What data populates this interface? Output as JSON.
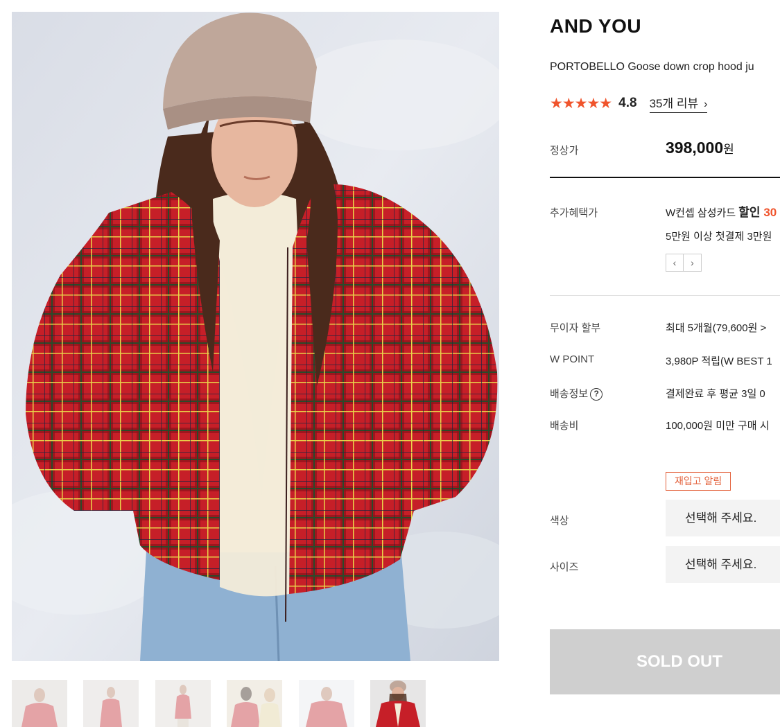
{
  "product": {
    "brand": "AND YOU",
    "name": "PORTOBELLO Goose down crop hood ju",
    "rating_stars": "★★★★★",
    "rating": "4.8",
    "review_link": "35개 리뷰",
    "review_chevron": "›"
  },
  "price": {
    "label": "정상가",
    "amount": "398,000",
    "unit": "원"
  },
  "benefits": {
    "label": "추가혜택가",
    "line1_prefix": "W컨셉 삼성카드 ",
    "line1_strong": "할인 ",
    "line1_accent": "30",
    "line2": "5만원 이상 첫결제 3만원",
    "prev_icon": "‹",
    "next_icon": "›"
  },
  "info": {
    "installment_label": "무이자 할부",
    "installment_value": "최대 5개월(79,600원 >",
    "point_label": "W POINT",
    "point_value": "3,980P 적립(W BEST 1",
    "shipping_info_label": "배송정보",
    "shipping_help_icon": "?",
    "shipping_info_value": "결제완료 후 평균 3일 0",
    "shipping_fee_label": "배송비",
    "shipping_fee_value": "100,000원 미만 구매 시"
  },
  "options": {
    "restock_button": "재입고 알림",
    "color_label": "색상",
    "color_placeholder": "선택해 주세요.",
    "size_label": "사이즈",
    "size_placeholder": "선택해 주세요."
  },
  "actions": {
    "soldout": "SOLD OUT"
  },
  "colors": {
    "accent": "#f0542c",
    "plaid_red": "#c8202a",
    "sold_out_bg": "#cfcfcf"
  }
}
